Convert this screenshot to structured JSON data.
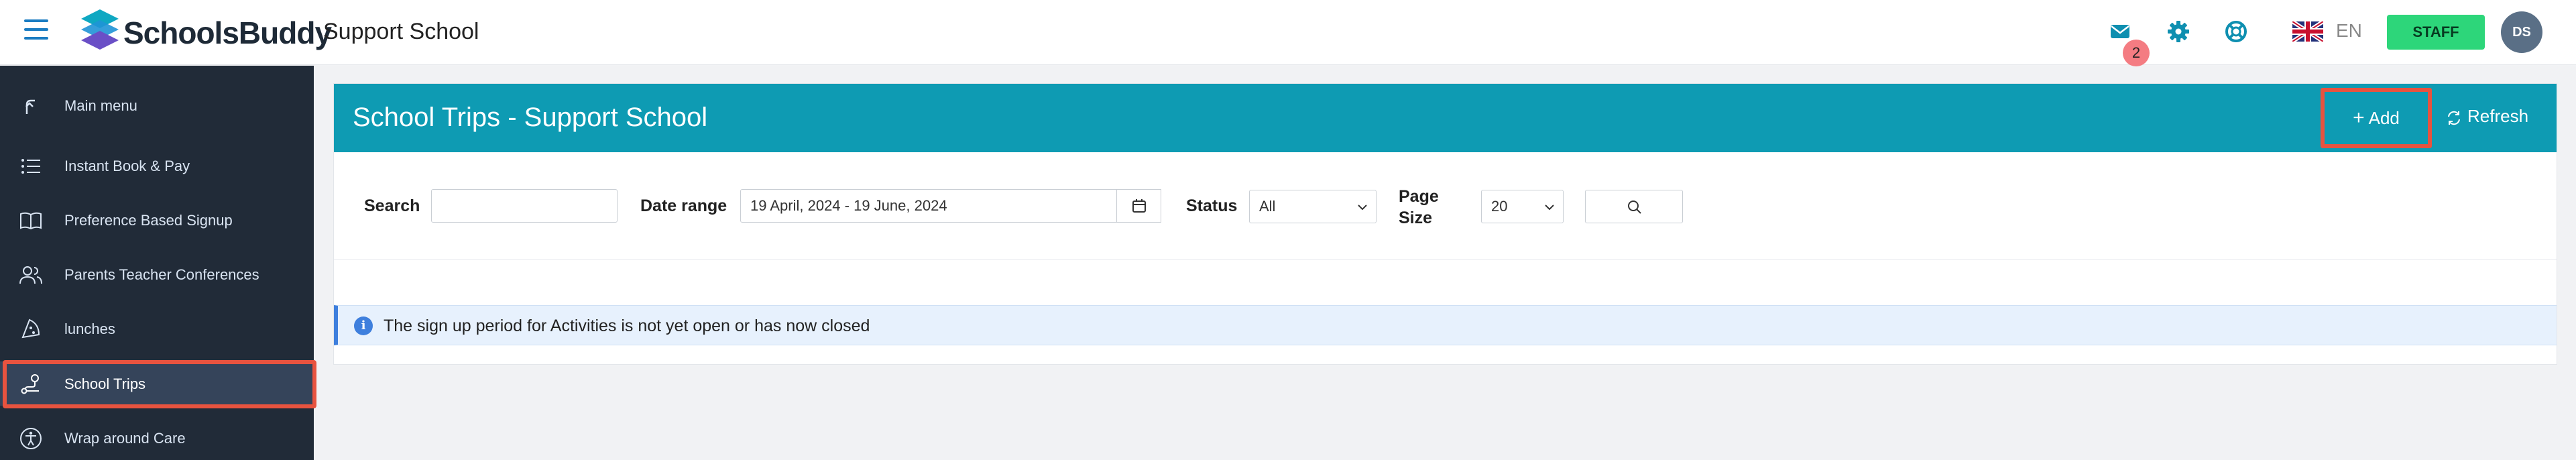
{
  "header": {
    "brand": "SchoolsBuddy",
    "school_name": "Support School",
    "mail_badge": "2",
    "language": "EN",
    "staff_label": "STAFF",
    "avatar_initials": "DS"
  },
  "sidebar": {
    "items": [
      {
        "label": "Main menu",
        "icon": "arrow-up-icon"
      },
      {
        "label": "Instant Book & Pay",
        "icon": "list-icon"
      },
      {
        "label": "Preference Based Signup",
        "icon": "book-icon"
      },
      {
        "label": "Parents Teacher Conferences",
        "icon": "people-icon"
      },
      {
        "label": "lunches",
        "icon": "food-icon"
      },
      {
        "label": "School Trips",
        "icon": "route-icon",
        "active": true
      },
      {
        "label": "Wrap around Care",
        "icon": "accessibility-icon"
      }
    ]
  },
  "panel": {
    "title": "School Trips - Support School",
    "add_label": "Add",
    "refresh_label": "Refresh"
  },
  "filters": {
    "search_label": "Search",
    "search_value": "",
    "date_range_label": "Date range",
    "date_range_value": "19 April, 2024 - 19 June, 2024",
    "status_label": "Status",
    "status_value": "All",
    "page_size_label_1": "Page",
    "page_size_label_2": "Size",
    "page_size_value": "20"
  },
  "alert": {
    "message": "The sign up period for Activities is not yet open or has now closed"
  },
  "colors": {
    "accent": "#0e9bb3",
    "sidebar_bg": "#212b38",
    "staff_green": "#2dd67a",
    "highlight": "#e8533f"
  }
}
